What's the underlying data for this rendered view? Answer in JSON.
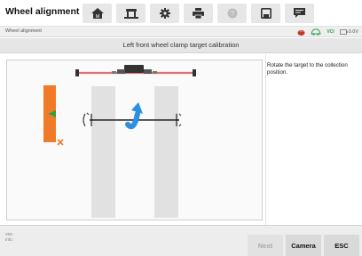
{
  "app": {
    "title": "Wheel alignment"
  },
  "toolbar": {
    "buttons": [
      {
        "name": "home",
        "icon": "home-icon"
      },
      {
        "name": "vehicle",
        "icon": "car-lift-icon"
      },
      {
        "name": "settings",
        "icon": "gear-icon"
      },
      {
        "name": "print",
        "icon": "printer-icon"
      },
      {
        "name": "help",
        "icon": "help-icon"
      },
      {
        "name": "save",
        "icon": "save-icon"
      },
      {
        "name": "message",
        "icon": "chat-icon"
      }
    ]
  },
  "subbar": {
    "title": "Wheel alignment",
    "status_icons": [
      "vci-connection-icon",
      "vehicle-icon",
      "vci-badge-icon",
      "battery-icon"
    ],
    "vci_label": "VCI",
    "battery_text": "0.0V"
  },
  "header": {
    "title": "Left front wheel clamp target calibration"
  },
  "instruction": {
    "text": "Rotate the target to the collection position."
  },
  "footer": {
    "vin_label": "VIN:",
    "info_label": "Info:",
    "buttons": {
      "next": "Next",
      "camera": "Camera",
      "esc": "ESC"
    }
  },
  "colors": {
    "target_orange": "#f07a28",
    "target_green": "#2e9e4a",
    "arrow_blue": "#2c8fe0",
    "beam_red": "#e07070",
    "button_disabled_text": "#a8a8a8"
  }
}
